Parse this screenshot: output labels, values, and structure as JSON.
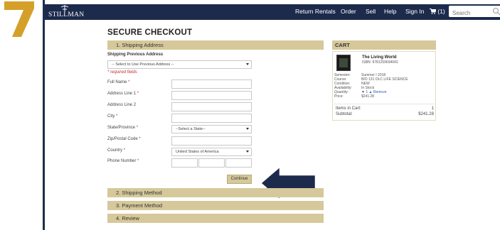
{
  "step": {
    "number": "7",
    "color": "#d4a02a"
  },
  "header": {
    "brand": "STILLMAN",
    "nav": [
      "Return Rentals",
      "Order",
      "Sell",
      "Help",
      "Sign In"
    ],
    "cart_label": "(1)",
    "search_placeholder": "Search",
    "bg_color": "#1c2a4c"
  },
  "checkout": {
    "title": "SECURE CHECKOUT",
    "sections": {
      "shipping_address": "1. Shipping Address",
      "shipping_method": "2. Shipping Method",
      "payment_method": "3. Payment Method",
      "review": "4. Review"
    },
    "previous_address_label": "Shipping Previous Address",
    "previous_address_select": "-- Select to Use Previous Address --",
    "required_note": "* required fields",
    "fields": {
      "full_name": "Full Name",
      "address1": "Address Line 1",
      "address2": "Address Line 2",
      "city": "City",
      "state": "State/Province",
      "zip": "Zip/Postal Code",
      "country": "Country",
      "phone": "Phone Number"
    },
    "required_marker": "*",
    "state_select": "--Select a State--",
    "country_select": "United States of America",
    "continue_label": "Continue",
    "accent_color": "#d6c89a"
  },
  "cart": {
    "title": "CART",
    "item": {
      "title": "The Living World",
      "isbn": "ISBN: 9781259694042",
      "semester_label": "Semester:",
      "semester": "Summer I 2018",
      "course_label": "Course:",
      "course": "BIO 131 OLC LIFE SCIENCE",
      "condition_label": "Condition:",
      "condition": "NEW",
      "availability_label": "Availability:",
      "availability": "In Stock",
      "quantity_label": "Quantity:",
      "quantity": "1",
      "remove": "Remove",
      "price_label": "Price:",
      "price": "$241.28"
    },
    "items_label": "Items in Cart:",
    "items_count": "1",
    "subtotal_label": "Subtotal:",
    "subtotal": "$241.28"
  }
}
